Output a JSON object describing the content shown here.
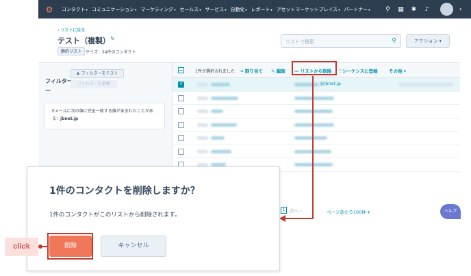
{
  "nav": {
    "items": [
      "コンタクト",
      "コミュニケーション",
      "マーケティング",
      "セールス",
      "サービス",
      "自動化",
      "レポート",
      "アセットマーケットプレイス",
      "パートナー"
    ]
  },
  "header": {
    "back_link": "‹ リストに戻る",
    "title": "テスト（複製）",
    "badge": "静的リスト",
    "size": "サイズ：24件のコンタクト",
    "search_placeholder": "リストで検索",
    "action_label": "アクション ▾"
  },
  "filters": {
    "label": "フィルター",
    "test_button": "フィルターをテスト",
    "edit_button": "フィルターを編集",
    "condition_prefix": "Eメールに次の値に完全一致する値が含まれたことがある：",
    "condition_value": "jbnet.jp"
  },
  "table": {
    "selected_count": "1件が選択されました",
    "assign": "割り当て",
    "edit": "編集",
    "remove_from_list": "リストから削除",
    "enroll_sequence": "シーケンスに登録",
    "more": "その他 ▾",
    "email_fragment": "@jbnet.jp"
  },
  "pagination": {
    "current_page": "1",
    "next": "次へ",
    "per_page": "ページあたり100件 ▾"
  },
  "help": "ヘルプ",
  "modal": {
    "title": "1件のコンタクトを削除しますか？",
    "body": "1件のコンタクトがこのリストから削除されます。",
    "delete": "削除",
    "cancel": "キャンセル"
  },
  "annotation": {
    "click": "click"
  }
}
